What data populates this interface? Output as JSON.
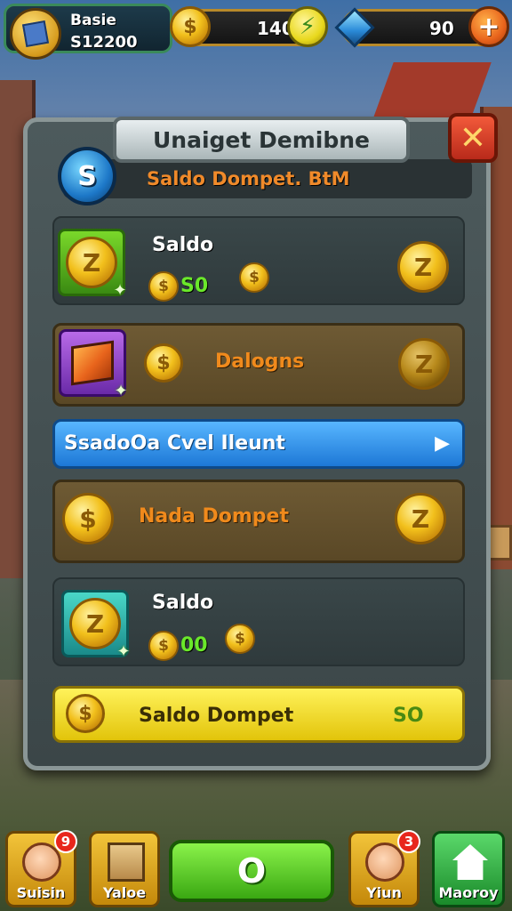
{
  "profile": {
    "name": "Basie",
    "value": "S12200"
  },
  "resources": {
    "coins": "140",
    "gems": "90"
  },
  "panel": {
    "title": "Unaiget Demibne",
    "subtitle": "Saldo Dompet. BtM",
    "badge": "S",
    "close_label": "✕"
  },
  "rows": [
    {
      "label": "Saldo",
      "amount": "S0"
    },
    {
      "label": "Dalogns"
    },
    {
      "label": "SsadoOa Cvel Ileunt",
      "arrow": "▶"
    },
    {
      "label": "Nada Dompet"
    },
    {
      "label": "Saldo",
      "amount": "00"
    },
    {
      "label": "Saldo Dompet",
      "amount": "SO"
    }
  ],
  "nav": {
    "item1": {
      "label": "Suisin",
      "badge": "9"
    },
    "item2": {
      "label": "Yaloe"
    },
    "play": {
      "label": "O"
    },
    "item4": {
      "label": "Yiun",
      "badge": "3"
    },
    "item5": {
      "label": "Maoroy"
    }
  },
  "icons": {
    "coin": "coin-icon",
    "bolt": "lightning-icon",
    "gem": "gem-icon",
    "plus": "plus-icon",
    "close": "close-icon",
    "box": "gift-box-icon",
    "home": "house-icon"
  },
  "colors": {
    "accent_orange": "#f08a1c",
    "accent_green": "#6ae82a",
    "panel_bg": "#4d5a5c",
    "blue_row": "#1d78d6",
    "yellow_row": "#e2c40a"
  }
}
